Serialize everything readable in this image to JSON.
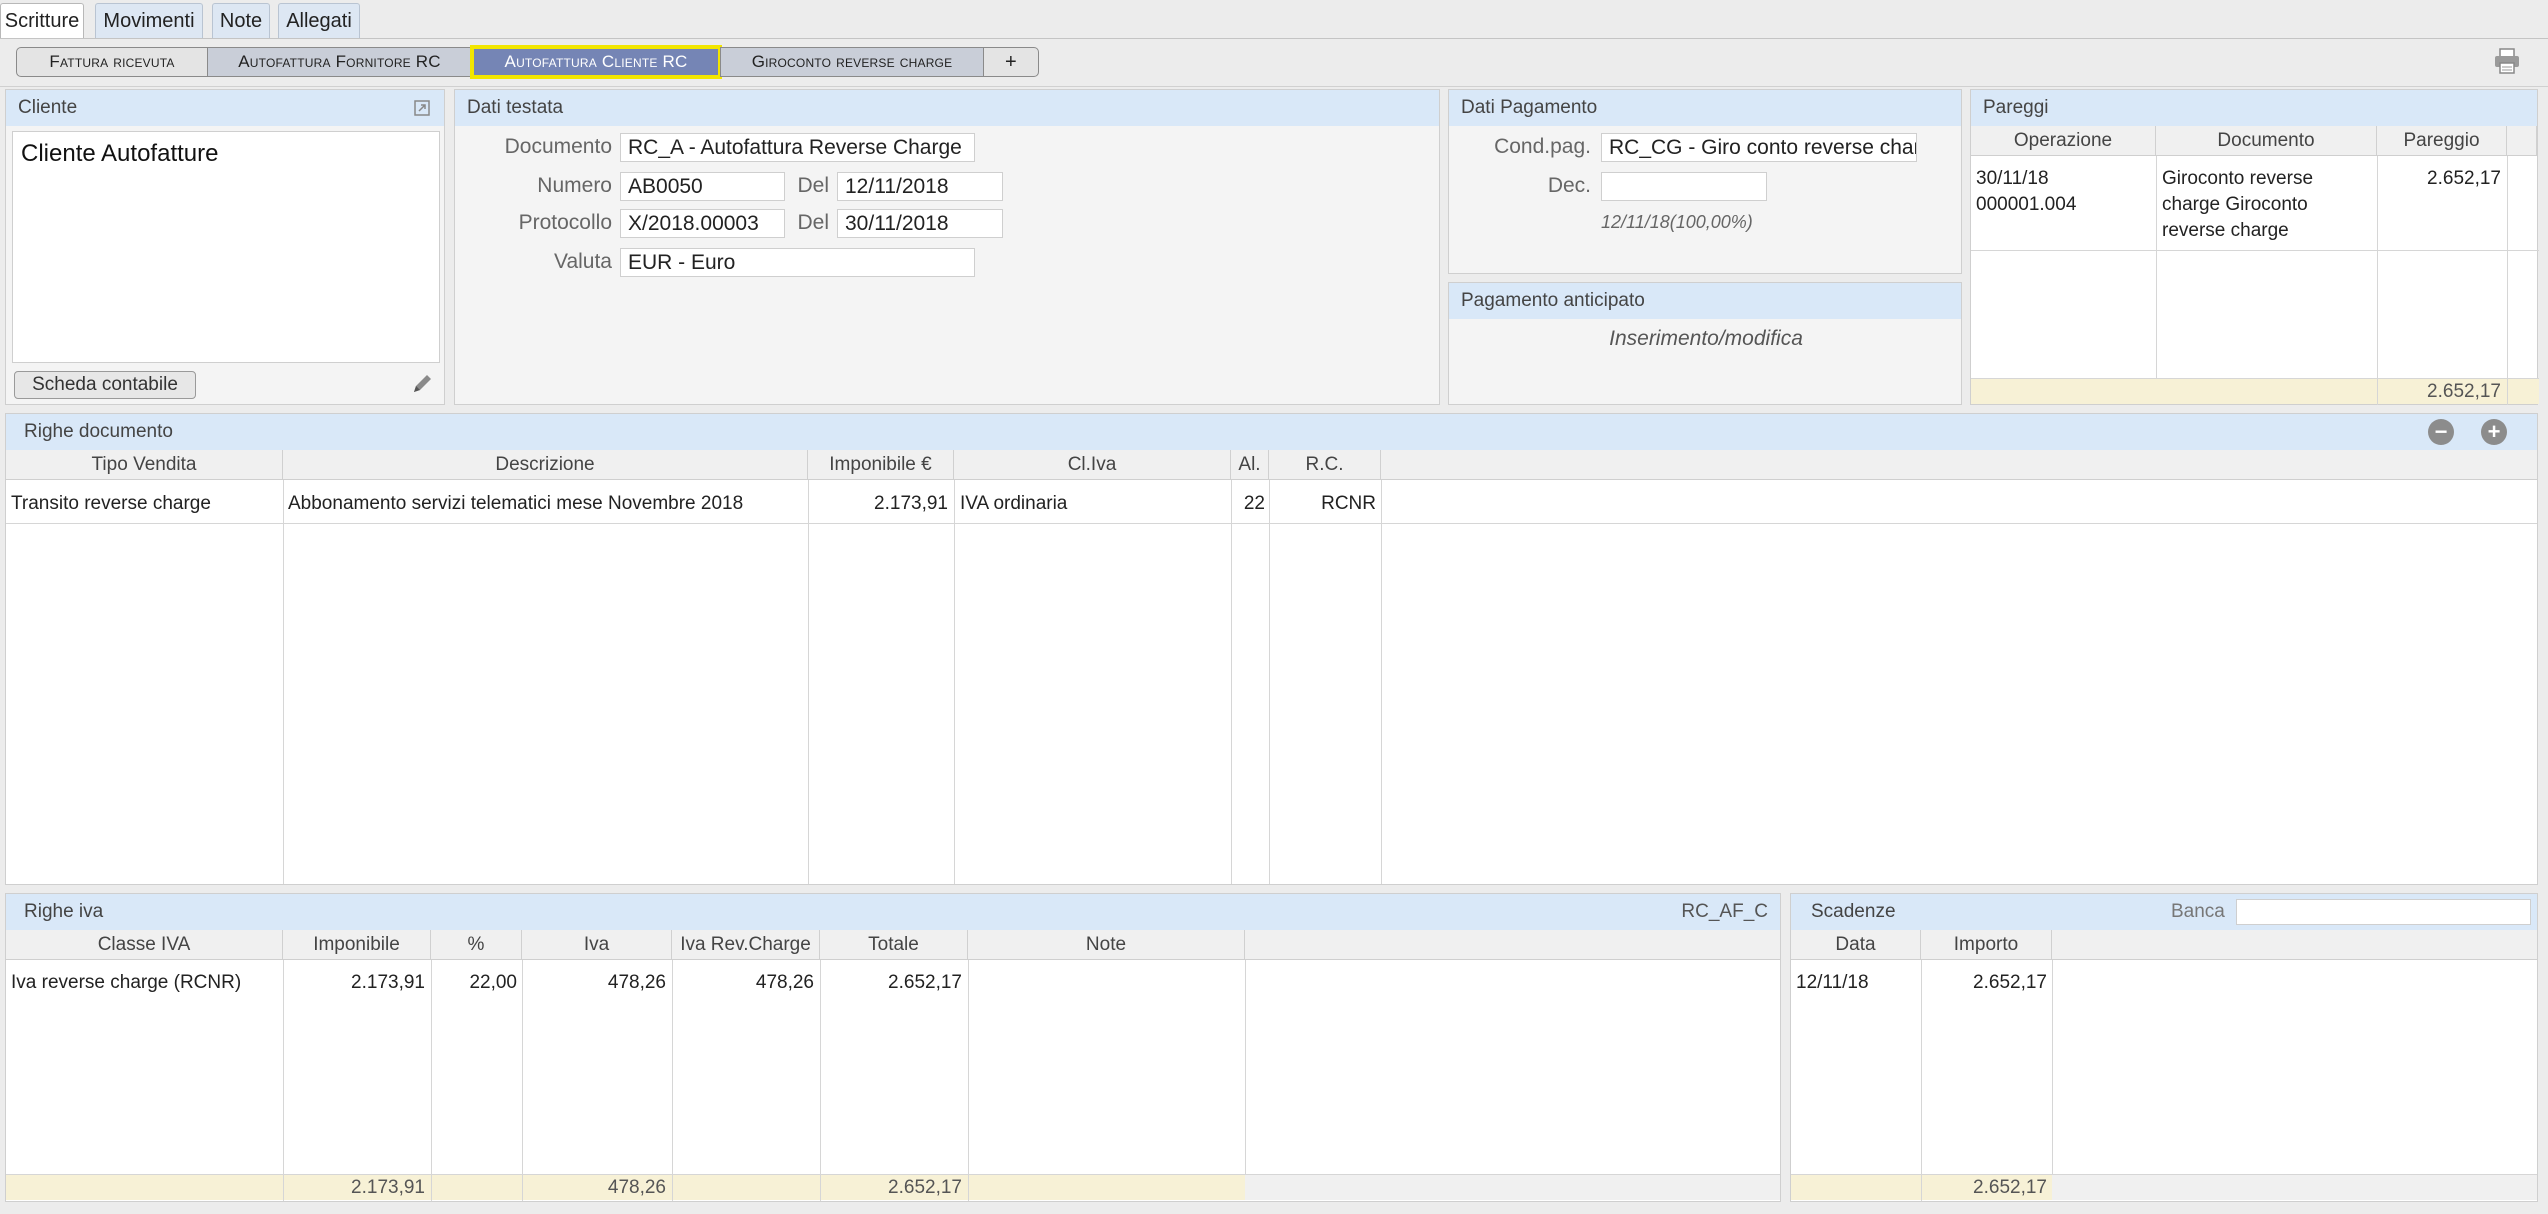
{
  "top_tabs": [
    "Scritture",
    "Movimenti",
    "Note",
    "Allegati"
  ],
  "sub_tabs": [
    "Fattura ricevuta",
    "Autofattura Fornitore RC",
    "Autofattura Cliente RC",
    "Giroconto reverse charge",
    "+"
  ],
  "cliente": {
    "title": "Cliente",
    "name": "Cliente Autofatture",
    "scheda_button": "Scheda contabile"
  },
  "dati_testata": {
    "title": "Dati testata",
    "documento_label": "Documento",
    "documento_value": "RC_A - Autofattura Reverse Charge",
    "numero_label": "Numero",
    "numero_value": "AB0050",
    "del_label": "Del",
    "numero_date": "12/11/2018",
    "protocollo_label": "Protocollo",
    "protocollo_value": "X/2018.00003",
    "protocollo_date": "30/11/2018",
    "valuta_label": "Valuta",
    "valuta_value": "EUR - Euro"
  },
  "dati_pagamento": {
    "title": "Dati Pagamento",
    "cond_label": "Cond.pag.",
    "cond_value": "RC_CG - Giro conto reverse charge",
    "dec_label": "Dec.",
    "dec_value": "",
    "schedule_note": "12/11/18(100,00%)"
  },
  "pagamento_anticipato": {
    "title": "Pagamento anticipato",
    "text": "Inserimento/modifica"
  },
  "pareggi": {
    "title": "Pareggi",
    "columns": [
      "Operazione",
      "Documento",
      "Pareggio"
    ],
    "row": {
      "operazione_line1": "30/11/18",
      "operazione_line2": "000001.004",
      "documento_line1": "Giroconto reverse",
      "documento_line2": "charge Giroconto",
      "documento_line3": "reverse charge",
      "pareggio": "2.652,17"
    },
    "total": "2.652,17"
  },
  "righe_documento": {
    "title": "Righe documento",
    "columns": [
      "Tipo Vendita",
      "Descrizione",
      "Imponibile €",
      "Cl.Iva",
      "Al.",
      "R.C."
    ],
    "rows": [
      {
        "tipo": "Transito reverse charge",
        "descrizione": "Abbonamento servizi telematici mese Novembre 2018",
        "imponibile": "2.173,91",
        "cliva": "IVA ordinaria",
        "al": "22",
        "rc": "RCNR"
      }
    ]
  },
  "righe_iva": {
    "title": "Righe iva",
    "code": "RC_AF_C",
    "columns": [
      "Classe IVA",
      "Imponibile",
      "%",
      "Iva",
      "Iva Rev.Charge",
      "Totale",
      "Note"
    ],
    "rows": [
      {
        "classe": "Iva reverse charge (RCNR)",
        "imponibile": "2.173,91",
        "perc": "22,00",
        "iva": "478,26",
        "iva_rc": "478,26",
        "totale": "2.652,17",
        "note": ""
      }
    ],
    "totals": {
      "imponibile": "2.173,91",
      "iva": "478,26",
      "totale": "2.652,17"
    }
  },
  "scadenze": {
    "title": "Scadenze",
    "banca_label": "Banca",
    "banca_value": "",
    "columns": [
      "Data",
      "Importo"
    ],
    "rows": [
      {
        "data": "12/11/18",
        "importo": "2.652,17"
      }
    ],
    "total": "2.652,17"
  }
}
